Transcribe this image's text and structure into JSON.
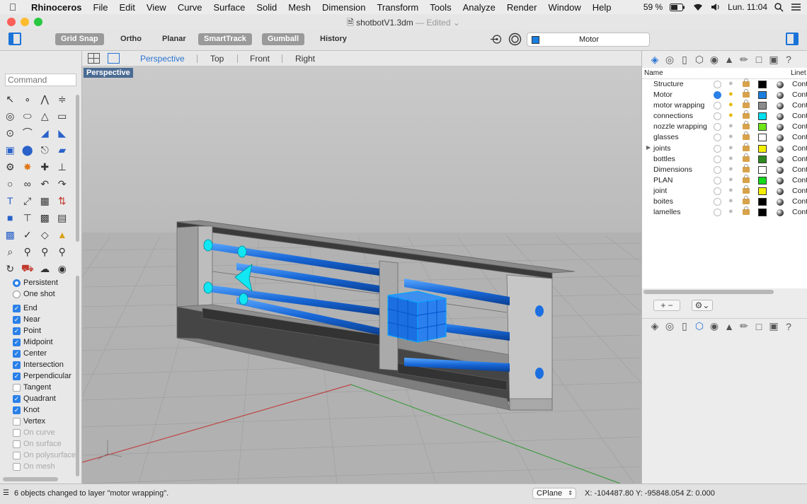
{
  "menubar": {
    "app_name": "Rhinoceros",
    "items": [
      "File",
      "Edit",
      "View",
      "Curve",
      "Surface",
      "Solid",
      "Mesh",
      "Dimension",
      "Transform",
      "Tools",
      "Analyze",
      "Render",
      "Window",
      "Help"
    ],
    "battery": "59 %",
    "clock": "Lun. 11:04"
  },
  "window": {
    "title": "shotbotV1.3dm",
    "edited": "— Edited"
  },
  "toolbar": {
    "grid_snap": "Grid Snap",
    "ortho": "Ortho",
    "planar": "Planar",
    "smarttrack": "SmartTrack",
    "gumball": "Gumball",
    "history": "History",
    "current_layer": "Motor",
    "current_layer_color": "#1b7fe0"
  },
  "command": {
    "placeholder": "Command"
  },
  "osnap": {
    "persistent": "Persistent",
    "one_shot": "One shot",
    "items": [
      {
        "label": "End",
        "checked": true,
        "enabled": true
      },
      {
        "label": "Near",
        "checked": true,
        "enabled": true
      },
      {
        "label": "Point",
        "checked": true,
        "enabled": true
      },
      {
        "label": "Midpoint",
        "checked": true,
        "enabled": true
      },
      {
        "label": "Center",
        "checked": true,
        "enabled": true
      },
      {
        "label": "Intersection",
        "checked": true,
        "enabled": true
      },
      {
        "label": "Perpendicular",
        "checked": true,
        "enabled": true
      },
      {
        "label": "Tangent",
        "checked": false,
        "enabled": true
      },
      {
        "label": "Quadrant",
        "checked": true,
        "enabled": true
      },
      {
        "label": "Knot",
        "checked": true,
        "enabled": true
      },
      {
        "label": "Vertex",
        "checked": false,
        "enabled": true
      },
      {
        "label": "On curve",
        "checked": false,
        "enabled": false
      },
      {
        "label": "On surface",
        "checked": false,
        "enabled": false
      },
      {
        "label": "On polysurface",
        "checked": false,
        "enabled": false
      },
      {
        "label": "On mesh",
        "checked": false,
        "enabled": false
      }
    ]
  },
  "viewport": {
    "tabs": [
      "Perspective",
      "Top",
      "Front",
      "Right"
    ],
    "active_tab": "Perspective",
    "label": "Perspective"
  },
  "layers": {
    "col_name": "Name",
    "col_linetype": "Linet",
    "items": [
      {
        "name": "Structure",
        "color": "#000000",
        "current": false,
        "bulb_lit": false,
        "linetype": "Cont",
        "expandable": false
      },
      {
        "name": "Motor",
        "color": "#1b7fe0",
        "current": true,
        "bulb_lit": true,
        "linetype": "Cont",
        "expandable": false
      },
      {
        "name": "motor wrapping",
        "color": "#8c8c8c",
        "current": false,
        "bulb_lit": true,
        "linetype": "Cont",
        "expandable": false
      },
      {
        "name": "connections",
        "color": "#00e0ee",
        "current": false,
        "bulb_lit": true,
        "linetype": "Cont",
        "expandable": false
      },
      {
        "name": "nozzle wrapping",
        "color": "#6ee61a",
        "current": false,
        "bulb_lit": false,
        "linetype": "Cont",
        "expandable": false
      },
      {
        "name": "glasses",
        "color": "#ffffff",
        "current": false,
        "bulb_lit": false,
        "linetype": "Cont",
        "expandable": false
      },
      {
        "name": "joints",
        "color": "#f5f000",
        "current": false,
        "bulb_lit": false,
        "linetype": "Cont",
        "expandable": true
      },
      {
        "name": "bottles",
        "color": "#2e8a1e",
        "current": false,
        "bulb_lit": false,
        "linetype": "Cont",
        "expandable": false
      },
      {
        "name": "Dimensions",
        "color": "#ffffff",
        "current": false,
        "bulb_lit": false,
        "linetype": "Cont",
        "expandable": false
      },
      {
        "name": "PLAN",
        "color": "#14d81a",
        "current": false,
        "bulb_lit": false,
        "linetype": "Cont",
        "expandable": false
      },
      {
        "name": "joint",
        "color": "#f5f000",
        "current": false,
        "bulb_lit": false,
        "linetype": "Cont",
        "expandable": false
      },
      {
        "name": "boites",
        "color": "#000000",
        "current": false,
        "bulb_lit": false,
        "linetype": "Cont",
        "expandable": false
      },
      {
        "name": "lamelles",
        "color": "#000000",
        "current": false,
        "bulb_lit": false,
        "linetype": "Cont",
        "expandable": false
      }
    ]
  },
  "statusbar": {
    "message": "6 objects changed to layer \"motor wrapping\".",
    "cplane": "CPlane",
    "coords": "X: -104487.80 Y: -95848.054  Z: 0.000"
  }
}
